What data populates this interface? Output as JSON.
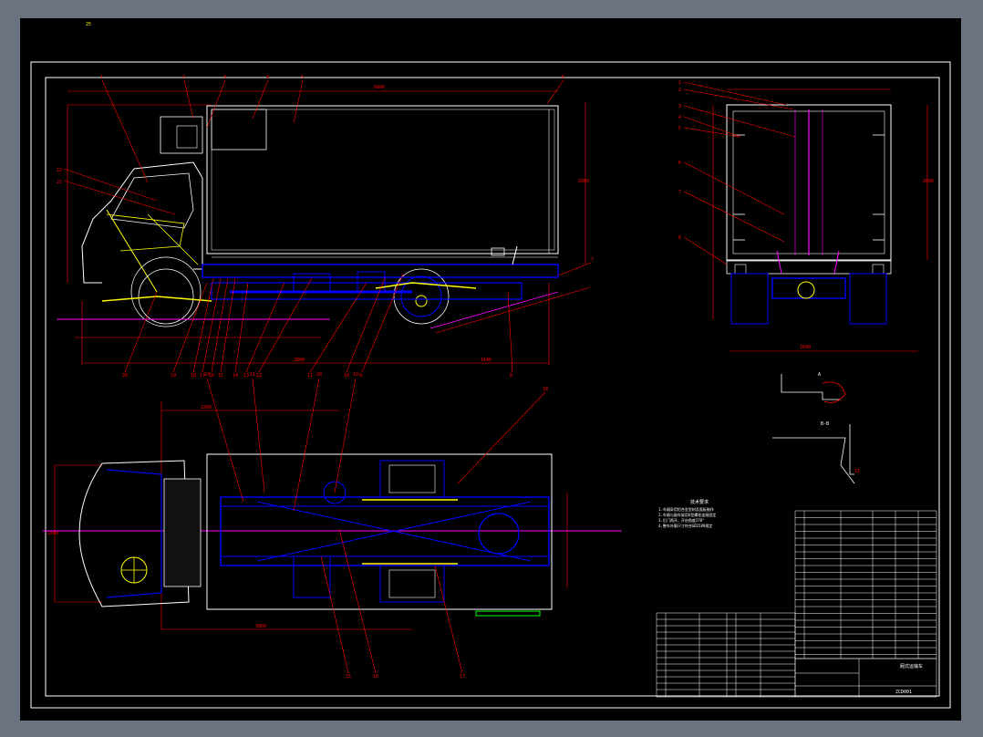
{
  "viewport": {
    "background": "#000000",
    "frame_color": "#ffffff",
    "frame_marker": "25"
  },
  "colors": {
    "outline": "#ffffff",
    "dimension": "#ff0000",
    "chassis": "#0000ff",
    "axis": "#ff00ff",
    "parts": "#ffff00",
    "accent": "#00ff00",
    "detail": "#00ffff"
  },
  "side_view": {
    "callouts_top": [
      "1",
      "2",
      "3",
      "4",
      "5",
      "6",
      "7"
    ],
    "callouts_left": [
      "22",
      "21"
    ],
    "callouts_bottom": [
      "20",
      "19",
      "18",
      "17",
      "16",
      "15",
      "14",
      "13",
      "12",
      "11",
      "10",
      "9",
      "8"
    ],
    "dimensions": [
      "6890",
      "2000",
      "3800",
      "1640"
    ]
  },
  "rear_view": {
    "callouts": [
      "1",
      "2",
      "3",
      "4",
      "5",
      "6",
      "7",
      "8"
    ],
    "dimensions": [
      "2000",
      "1640"
    ]
  },
  "plan_view": {
    "callouts_top": [
      "22",
      "21",
      "20",
      "19",
      "18"
    ],
    "callouts_bottom": [
      "15",
      "16",
      "17"
    ],
    "dimensions": [
      "2200",
      "3000",
      "1800"
    ]
  },
  "details": {
    "detail_a_label": "A",
    "detail_b_label": "B-B",
    "detail_b_mark": "15"
  },
  "notes": {
    "heading": "技术要求",
    "lines": [
      "1.车厢采用铝合金型材及面板制作",
      "2.车厢与副车架用U型螺栓连接固定",
      "3.后门两开，开启角度270°",
      "4.整车外廓尺寸符合GB1589规定"
    ]
  },
  "title_block": {
    "product_name": "厢式运输车",
    "drawing_number": "ZCD001"
  }
}
